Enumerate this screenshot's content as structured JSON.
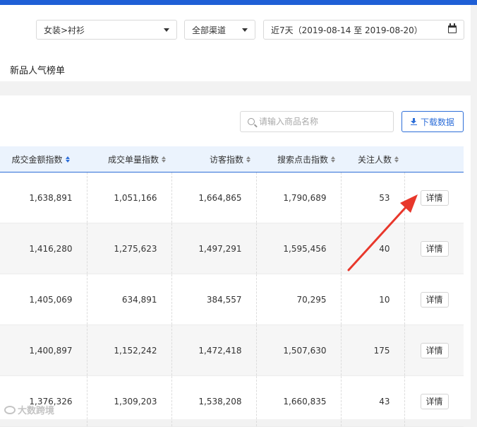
{
  "filters": {
    "category": "女装>衬衫",
    "channel": "全部渠道",
    "date_range": "近7天（2019-08-14 至 2019-08-20）"
  },
  "section": {
    "title": "新品人气榜单"
  },
  "search": {
    "placeholder": "请输入商品名称"
  },
  "download": {
    "label": "下载数据"
  },
  "table": {
    "columns": [
      "成交金额指数",
      "成交单量指数",
      "访客指数",
      "搜索点击指数",
      "关注人数"
    ],
    "rows": [
      [
        "1,638,891",
        "1,051,166",
        "1,664,865",
        "1,790,689",
        "53",
        "详情"
      ],
      [
        "1,416,280",
        "1,275,623",
        "1,497,291",
        "1,595,456",
        "40",
        "详情"
      ],
      [
        "1,405,069",
        "634,891",
        "384,557",
        "70,295",
        "10",
        "详情"
      ],
      [
        "1,400,897",
        "1,152,242",
        "1,472,418",
        "1,507,630",
        "175",
        "详情"
      ],
      [
        "1,376,326",
        "1,309,203",
        "1,538,208",
        "1,660,835",
        "43",
        "详情"
      ]
    ]
  },
  "annotation": {
    "arrow_color": "#e8372b"
  },
  "watermark": {
    "text": "大数跨境"
  },
  "colors": {
    "accent": "#2d6ed8",
    "topbar": "#1f5fd6"
  }
}
